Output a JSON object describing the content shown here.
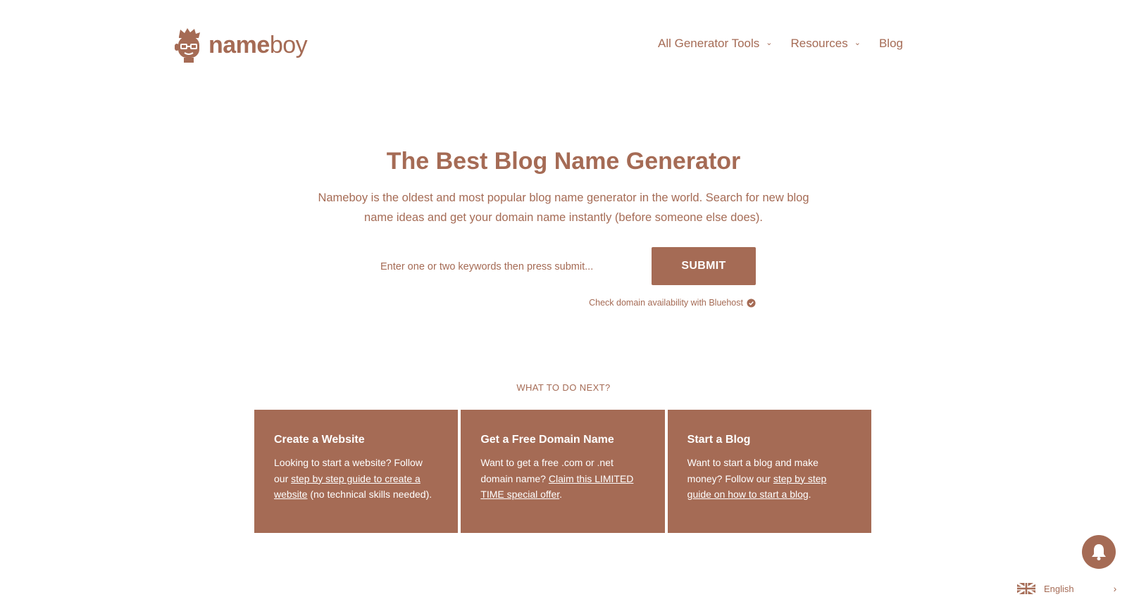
{
  "brand": {
    "name_bold": "name",
    "name_regular": "boy"
  },
  "nav": [
    {
      "label": "All Generator Tools",
      "dropdown": true
    },
    {
      "label": "Resources",
      "dropdown": true
    },
    {
      "label": "Blog",
      "dropdown": false
    }
  ],
  "hero": {
    "title": "The Best Blog Name Generator",
    "subtitle": "Nameboy is the oldest and most popular blog name generator in the world. Search for new blog name ideas and get your domain name instantly (before someone else does)."
  },
  "search": {
    "placeholder": "Enter one or two keywords then press submit...",
    "value": "",
    "submit_label": "SUBMIT",
    "availability_note": "Check domain availability with Bluehost"
  },
  "next": {
    "heading": "WHAT TO DO NEXT?",
    "cards": [
      {
        "title": "Create a Website",
        "text_before": "Looking to start a website? Follow our ",
        "link": "step by step guide to create a website",
        "text_after": " (no technical skills needed)."
      },
      {
        "title": "Get a Free Domain Name",
        "text_before": "Want to get a free .com or .net domain name? ",
        "link": "Claim this LIMITED TIME special offer",
        "text_after": "."
      },
      {
        "title": "Start a Blog",
        "text_before": "Want to start a blog and make money? Follow our ",
        "link": "step by step guide on how to start a blog",
        "text_after": "."
      }
    ]
  },
  "language": {
    "label": "English"
  },
  "colors": {
    "brand": "#a56b55",
    "background": "#ffffff",
    "card_text": "#ffffff"
  },
  "icons": [
    "nameboy-logo-icon",
    "chevron-down-icon",
    "check-circle-icon",
    "bell-icon",
    "uk-flag-icon",
    "chevron-right-icon"
  ]
}
